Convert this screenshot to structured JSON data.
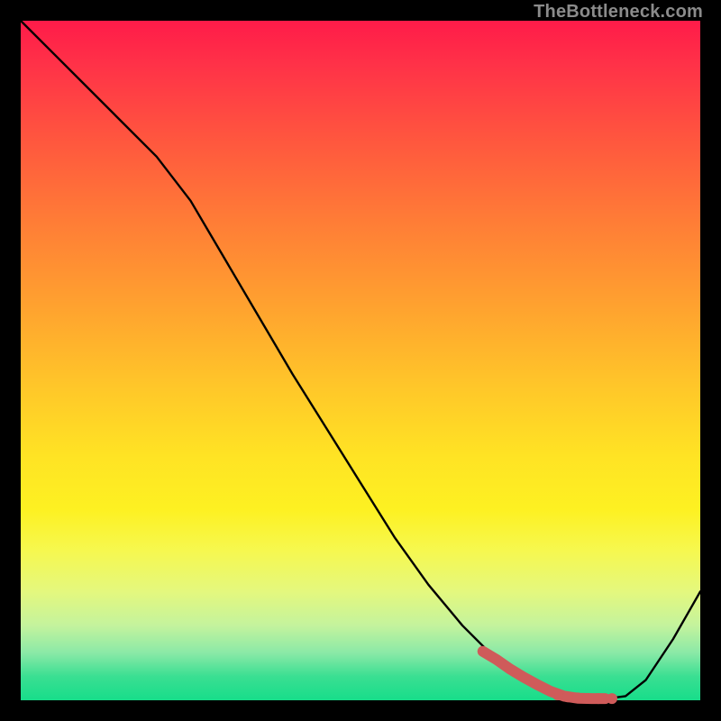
{
  "watermark": "TheBottleneck.com",
  "colors": {
    "curve_stroke": "#000000",
    "highlight_stroke": "#cf5b5a",
    "highlight_fill": "#cf5b5a"
  },
  "chart_data": {
    "type": "line",
    "title": "",
    "xlabel": "",
    "ylabel": "",
    "xlim": [
      0,
      100
    ],
    "ylim": [
      0,
      100
    ],
    "grid": false,
    "series": [
      {
        "name": "bottleneck-curve",
        "x": [
          0,
          5,
          10,
          15,
          20,
          25,
          30,
          35,
          40,
          45,
          50,
          55,
          60,
          65,
          70,
          75,
          80,
          83,
          86,
          89,
          92,
          96,
          100
        ],
        "values": [
          100,
          95,
          90,
          85,
          80,
          73.5,
          65,
          56.5,
          48,
          40,
          32,
          24,
          17,
          11,
          6,
          2.5,
          0.6,
          0.2,
          0.2,
          0.6,
          3,
          9,
          16
        ]
      }
    ],
    "highlight_segment": {
      "name": "optimal-range",
      "x": [
        68,
        70,
        72,
        74,
        76,
        78,
        80,
        82,
        84,
        86
      ],
      "values": [
        7.2,
        6,
        4.6,
        3.4,
        2.3,
        1.3,
        0.6,
        0.3,
        0.25,
        0.25
      ]
    },
    "highlight_dots": {
      "name": "optimal-dots",
      "x": [
        79,
        80.5,
        82,
        83.5,
        85,
        87
      ],
      "values": [
        0.8,
        0.5,
        0.35,
        0.28,
        0.25,
        0.25
      ]
    }
  }
}
